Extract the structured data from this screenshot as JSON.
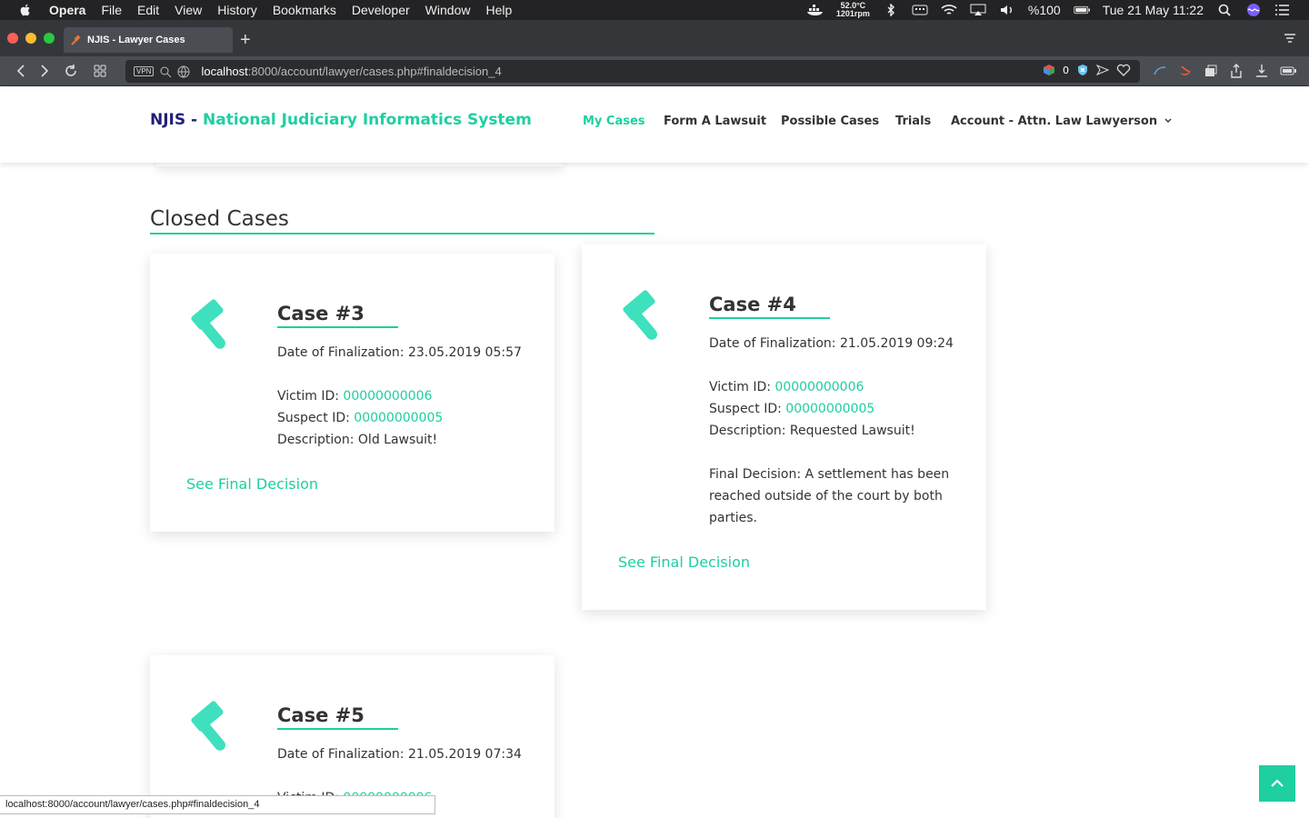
{
  "menubar": {
    "app": "Opera",
    "items": [
      "File",
      "Edit",
      "View",
      "History",
      "Bookmarks",
      "Developer",
      "Window",
      "Help"
    ],
    "temp": "52.0°C",
    "rpm": "1201rpm",
    "battery": "%100",
    "datetime": "Tue 21 May  11:22"
  },
  "browser": {
    "tab_title": "NJIS - Lawyer Cases",
    "vpn": "VPN",
    "url_host": "localhost",
    "url_path": ":8000/account/lawyer/cases.php#finaldecision_4",
    "badge_count": "0",
    "status_url": "localhost:8000/account/lawyer/cases.php#finaldecision_4"
  },
  "site": {
    "brand_abbr": "NJIS - ",
    "brand_full": "National Judiciary Informatics System",
    "nav": {
      "my_cases": "My Cases",
      "form_lawsuit": "Form A Lawsuit",
      "possible_cases": "Possible Cases",
      "trials": "Trials",
      "account": "Account - Attn. Law Lawyerson"
    },
    "section_title": "Closed Cases"
  },
  "labels": {
    "date_label": "Date of Finalization: ",
    "victim_label": "Victim ID: ",
    "suspect_label": "Suspect ID: ",
    "description_label": "Description: ",
    "final_decision_label": "Final Decision: ",
    "see_final": "See Final Decision"
  },
  "cases": {
    "c3": {
      "title": "Case #3",
      "date": "23.05.2019 05:57",
      "victim_id": "00000000006",
      "suspect_id": "00000000005",
      "description": "Old Lawsuit!"
    },
    "c4": {
      "title": "Case #4",
      "date": "21.05.2019 09:24",
      "victim_id": "00000000006",
      "suspect_id": "00000000005",
      "description": "Requested Lawsuit!",
      "final_line1": "A settlement has been",
      "final_line2": "reached outside of the court by both",
      "final_line3": "parties."
    },
    "c5": {
      "title": "Case #5",
      "date": "21.05.2019 07:34",
      "victim_id": "00000000006"
    }
  },
  "colors": {
    "accent": "#1ecfa0",
    "brand_dark": "#1f1f7a",
    "gavel": "#3ee0bd"
  }
}
